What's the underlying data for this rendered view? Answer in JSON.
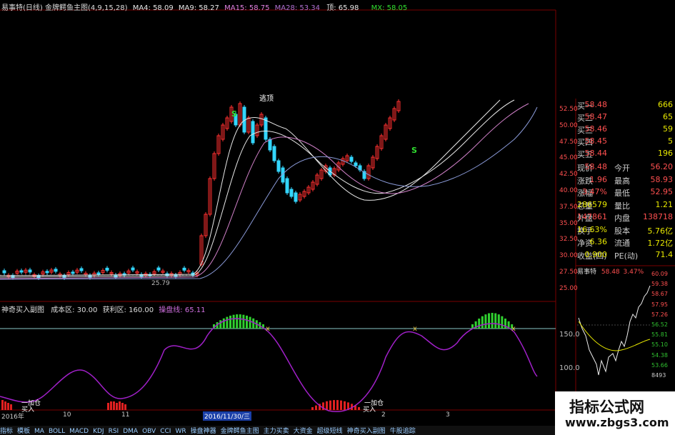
{
  "main_header": {
    "title": "易事特(日线) 金牌鳄鱼主图(4,9,15,28)",
    "ma4": "MA4: 58.09",
    "ma9": "MA9: 58.27",
    "ma15": "MA15: 58.75",
    "ma28": "MA28: 53.34",
    "top": "顶: 65.98",
    "mx": "MX: 58.05"
  },
  "annotations": {
    "escape_top": "逃顶",
    "s1": "S",
    "s2": "S",
    "low_price": "25.79",
    "add1": "一加仓",
    "buy1": "买入",
    "add2": "一加仓",
    "buy2": "买入"
  },
  "price_axis": [
    "52.50",
    "50.00",
    "47.50",
    "45.00",
    "42.50",
    "40.00",
    "37.50",
    "35.00",
    "32.50",
    "30.00",
    "27.50",
    "25.00"
  ],
  "sub_header": {
    "title": "神奇买入副图",
    "cost": "成本区: 30.00",
    "profit": "获利区: 160.00",
    "trade": "操盘线: 65.11"
  },
  "sub_axis": [
    "150.0",
    "100.0"
  ],
  "x_axis": {
    "year": "2016年",
    "m10": "10",
    "m11": "11",
    "date": "2016/11/30/三",
    "m2": "2",
    "m3": "3"
  },
  "bottom_tabs": [
    "指标",
    "模板",
    "MA",
    "BOLL",
    "MACD",
    "KDJ",
    "RSI",
    "DMA",
    "OBV",
    "CCI",
    "WR",
    "操盘神器",
    "金牌鳄鱼主图",
    "主力买卖",
    "大资金",
    "超级短线",
    "神奇买入副图",
    "牛股追踪"
  ],
  "quote": {
    "bids": [
      {
        "label": "买一",
        "value": "58.48",
        "vol": "666"
      },
      {
        "label": "买二",
        "value": "58.47",
        "vol": "65"
      },
      {
        "label": "买三",
        "value": "58.46",
        "vol": "59"
      },
      {
        "label": "买四",
        "value": "58.45",
        "vol": "5"
      },
      {
        "label": "买五",
        "value": "58.44",
        "vol": "196"
      }
    ],
    "stats": [
      {
        "l1": "现价",
        "v1": "58.48",
        "l2": "今开",
        "v2": "56.20"
      },
      {
        "l1": "涨跌",
        "v1": "1.96",
        "l2": "最高",
        "v2": "58.93"
      },
      {
        "l1": "涨幅",
        "v1": "3.47%",
        "l2": "最低",
        "v2": "52.95"
      },
      {
        "l1": "总量",
        "v1": "286579",
        "l2": "量比",
        "v2": "1.21"
      },
      {
        "l1": "外盘",
        "v1": "147861",
        "l2": "内盘",
        "v2": "138718"
      },
      {
        "l1": "换手",
        "v1": "16.63%",
        "l2": "股本",
        "v2": "5.76亿"
      },
      {
        "l1": "净资",
        "v1": "6.36",
        "l2": "流通",
        "v2": "1.72亿"
      },
      {
        "l1": "收益(四)",
        "v1": "0.900",
        "l2": "PE(动)",
        "v2": "71.4"
      }
    ]
  },
  "intraday": {
    "name": "易事特",
    "price": "58.48",
    "pct": "3.47%",
    "axis": [
      "60.09",
      "59.38",
      "58.67",
      "57.95",
      "57.26",
      "56.52",
      "55.81",
      "55.10",
      "54.38",
      "53.66",
      "8493"
    ]
  },
  "watermark": {
    "title": "指标公式网",
    "url": "www.zbgs3.com"
  },
  "colors": {
    "up": "#ff3030",
    "down": "#33d6ff",
    "ma_white": "#e8e8e8",
    "ma_pink": "#d080c8",
    "purple_line": "#a020c8",
    "green_hist": "#30d030",
    "red_hist": "#e02020",
    "grid_red": "#7a0000"
  }
}
